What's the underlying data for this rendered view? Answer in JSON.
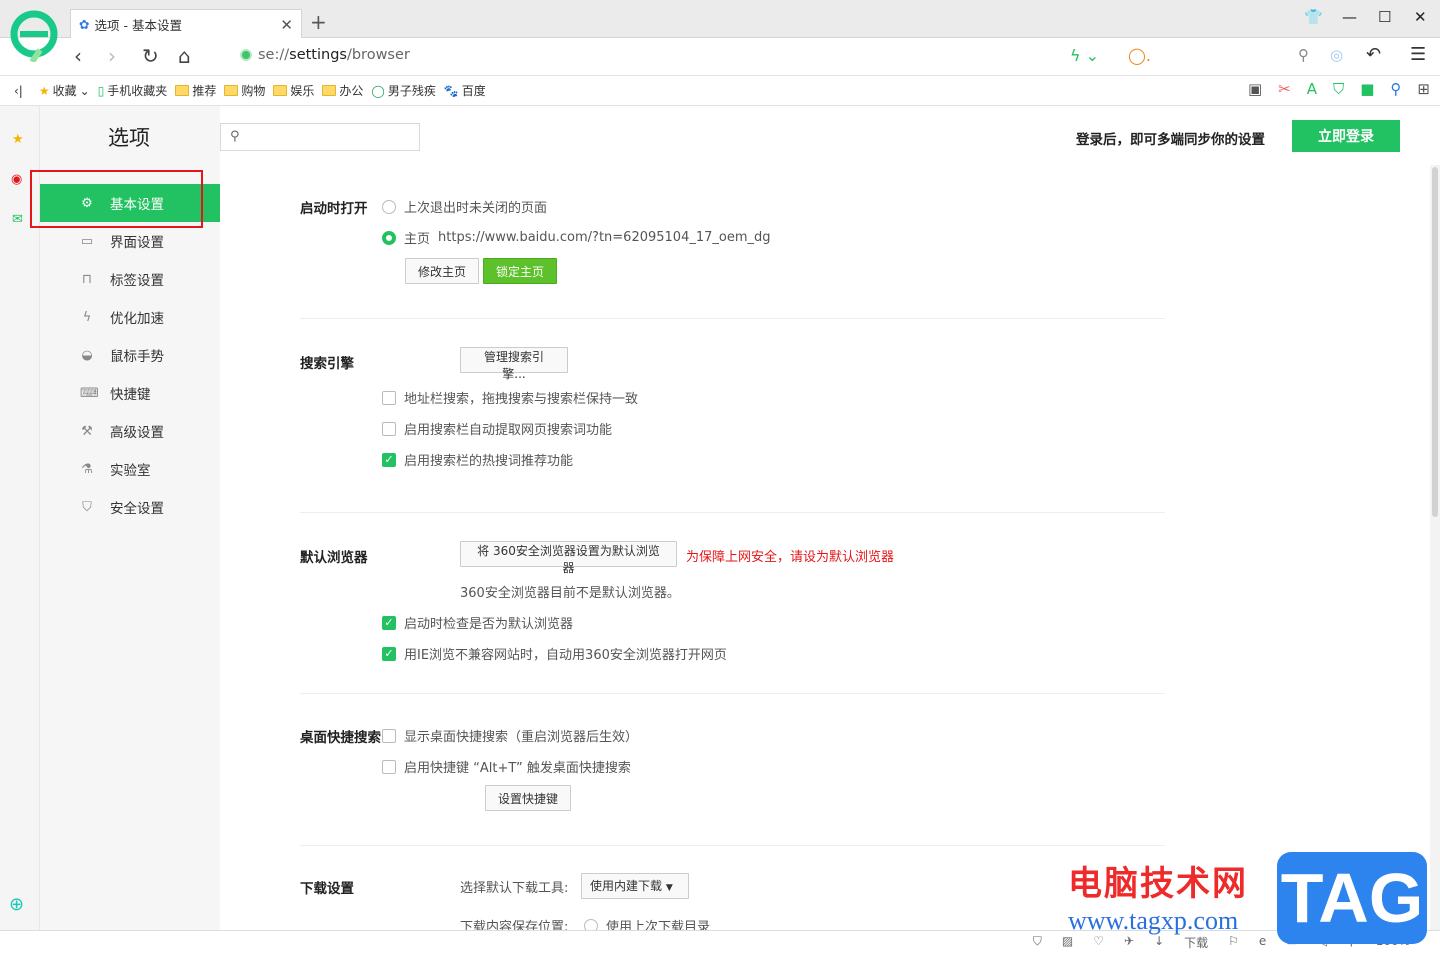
{
  "browser": {
    "tab_title": "选项 - 基本设置",
    "address_scheme": "se://",
    "address_path": "settings",
    "address_rest": "/browser",
    "bookmarks": [
      "收藏",
      "手机收藏夹",
      "推荐",
      "购物",
      "娱乐",
      "办公",
      "男子残疾",
      "百度"
    ]
  },
  "header": {
    "title": "选项",
    "search_placeholder": "",
    "login_tip": "登录后，即可多端同步你的设置",
    "login_button": "立即登录"
  },
  "sidebar": {
    "items": [
      {
        "label": "基本设置",
        "icon": "gear-icon",
        "active": true
      },
      {
        "label": "界面设置",
        "icon": "window-icon"
      },
      {
        "label": "标签设置",
        "icon": "tab-icon"
      },
      {
        "label": "优化加速",
        "icon": "lightning-icon"
      },
      {
        "label": "鼠标手势",
        "icon": "mouse-icon"
      },
      {
        "label": "快捷键",
        "icon": "keyboard-icon"
      },
      {
        "label": "高级设置",
        "icon": "wrench-icon"
      },
      {
        "label": "实验室",
        "icon": "flask-icon"
      },
      {
        "label": "安全设置",
        "icon": "shield-icon"
      }
    ]
  },
  "startup": {
    "heading": "启动时打开",
    "opt1": "上次退出时未关闭的页面",
    "opt2": "主页",
    "homepage_url": "https://www.baidu.com/?tn=62095104_17_oem_dg",
    "selected": "opt2",
    "modify_btn": "修改主页",
    "lock_btn": "锁定主页"
  },
  "search_engine": {
    "heading": "搜索引擎",
    "manage_btn": "管理搜索引擎...",
    "options": [
      {
        "label": "地址栏搜索，拖拽搜索与搜索栏保持一致",
        "checked": false
      },
      {
        "label": "启用搜索栏自动提取网页搜索词功能",
        "checked": false
      },
      {
        "label": "启用搜索栏的热搜词推荐功能",
        "checked": true
      }
    ]
  },
  "default_browser": {
    "heading": "默认浏览器",
    "set_btn": "将 360安全浏览器设置为默认浏览器",
    "warning": "为保障上网安全，请设为默认浏览器",
    "status": "360安全浏览器目前不是默认浏览器。",
    "options": [
      {
        "label": "启动时检查是否为默认浏览器",
        "checked": true
      },
      {
        "label": "用IE浏览不兼容网站时，自动用360安全浏览器打开网页",
        "checked": true
      }
    ]
  },
  "desktop_search": {
    "heading": "桌面快捷搜索",
    "options": [
      {
        "label": "显示桌面快捷搜索（重启浏览器后生效）",
        "checked": false
      },
      {
        "label": "启用快捷键 “Alt+T” 触发桌面快捷搜索",
        "checked": false
      }
    ],
    "shortcut_btn": "设置快捷键"
  },
  "download": {
    "heading": "下载设置",
    "tool_label": "选择默认下载工具:",
    "tool_value": "使用内建下载",
    "save_label": "下载内容保存位置:",
    "save_opt1": "使用上次下载目录"
  },
  "status_bar": {
    "download": "下载",
    "zoom": "100%"
  },
  "watermark": {
    "text1": "电脑技术网",
    "text2": "www.tagxp.com",
    "logo": "TAG"
  },
  "colors": {
    "accent": "#22c161",
    "warning": "#e5161a"
  }
}
